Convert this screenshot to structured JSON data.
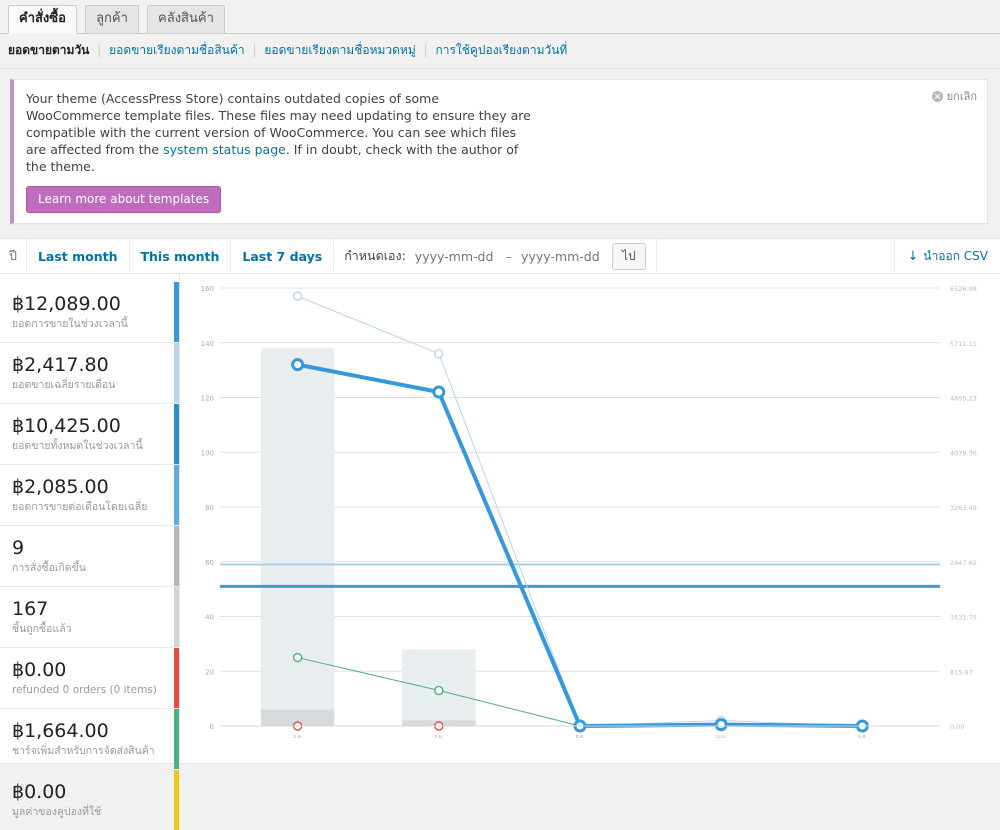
{
  "tabs": [
    {
      "label": "คำสั่งซื้อ",
      "active": true
    },
    {
      "label": "ลูกค้า",
      "active": false
    },
    {
      "label": "คลังสินค้า",
      "active": false
    }
  ],
  "subnav": [
    {
      "label": "ยอดขายตามวัน",
      "current": true
    },
    {
      "label": "ยอดขายเรียงตามชื่อสินค้า",
      "current": false
    },
    {
      "label": "ยอดขายเรียงตามชื่อหมวดหมู่",
      "current": false
    },
    {
      "label": "การใช้คูปองเรียงตามวันที่",
      "current": false
    }
  ],
  "notice": {
    "text_1": "Your theme (AccessPress Store) contains outdated copies of some WooCommerce template files. These files may need updating to ensure they are compatible with the current version of WooCommerce. You can see which files are affected from the ",
    "link_text": "system status page",
    "text_2": ". If in doubt, check with the author of the theme.",
    "button_label": "Learn more about templates",
    "dismiss_label": "ยกเลิก",
    "accent_color": "#c38ec7"
  },
  "toolbar": {
    "year_label": "ปี",
    "last_month": "Last month",
    "this_month": "This month",
    "last_7_days": "Last 7 days",
    "custom_label": "กำหนดเอง:",
    "date_from_placeholder": "yyyy-mm-dd",
    "date_to_placeholder": "yyyy-mm-dd",
    "date_from_value": "",
    "date_to_value": "",
    "dash": "–",
    "go_label": "ไป",
    "export_label": "นำออก CSV"
  },
  "legend": [
    {
      "value": "฿12,089.00",
      "desc": "ยอดการขายในช่วงเวลานี้",
      "color": "#3498db"
    },
    {
      "value": "฿2,417.80",
      "desc": "ยอดขายเฉลี่ยรายเดือน",
      "color": "#b8d5ea"
    },
    {
      "value": "฿10,425.00",
      "desc": "ยอดขายทั้งหมดในช่วงเวลานี้",
      "color": "#2e8ecb"
    },
    {
      "value": "฿2,085.00",
      "desc": "ยอดการขายต่อเดือนโดยเฉลี่ย",
      "color": "#5dade2"
    },
    {
      "value": "9",
      "desc": "การสั่งซื้อเกิดขึ้น",
      "color": "#b0b9bd"
    },
    {
      "value": "167",
      "desc": "ชิ้นถูกซื้อแล้ว",
      "color": "#cfd6d9"
    },
    {
      "value": "฿0.00",
      "desc": "refunded 0 orders (0 items)",
      "color": "#e74c3c"
    },
    {
      "value": "฿1,664.00",
      "desc": "ชาร์จเพิ่มสำหรับการจัดส่งสินค้า",
      "color": "#4caf82"
    },
    {
      "value": "฿0.00",
      "desc": "มูลค่าของคูปองที่ใช้",
      "color": "#f0c419"
    }
  ],
  "chart_data": {
    "type": "line",
    "title": "",
    "xlabel": "",
    "ylabel": "",
    "x": [
      "ม.ค.",
      "ก.พ.",
      "มี.ค.",
      "เม.ย.",
      "พ.ค."
    ],
    "ylim": [
      0,
      160
    ],
    "yticks": [
      0,
      20,
      40,
      60,
      80,
      100,
      120,
      140,
      160
    ],
    "y2lim": [
      0,
      6526.98
    ],
    "y2ticks": [
      "0.00",
      "815.87",
      "1631.75",
      "2447.62",
      "3263.49",
      "4079.36",
      "4895.23",
      "5711.11",
      "6526.98"
    ],
    "grid": true,
    "legend_position": "left-panel",
    "series": [
      {
        "name": "ยอดการขายในช่วงเวลานี้",
        "type": "line",
        "color": "#3498db",
        "width": 4,
        "values": [
          132,
          122,
          0,
          0.5,
          0
        ]
      },
      {
        "name": "ยอดขายทั้งหมดในช่วงเวลานี้",
        "type": "line",
        "color": "#b8d5ea",
        "width": 1,
        "values": [
          157,
          136,
          0,
          2,
          0
        ]
      },
      {
        "name": "ชาร์จเพิ่มสำหรับการจัดส่งสินค้า",
        "type": "line",
        "color": "#4caf82",
        "width": 1,
        "values": [
          25,
          13,
          0,
          0,
          0
        ]
      },
      {
        "name": "refunded 0 orders (0 items)",
        "type": "line",
        "color": "#e74c3c",
        "width": 1,
        "values": [
          0,
          0,
          0,
          0,
          0
        ]
      },
      {
        "name": "ชิ้นถูกซื้อแล้ว",
        "type": "bar",
        "color": "#e8edef",
        "values": [
          138,
          28,
          0,
          0,
          0
        ]
      },
      {
        "name": "การสั่งซื้อเกิดขึ้น",
        "type": "bar",
        "color": "#d5dbdd",
        "values": [
          6,
          2,
          0,
          0,
          0
        ]
      },
      {
        "name": "ยอดขายเฉลี่ยรายเดือน",
        "type": "hline",
        "color": "#a8cfe8",
        "width": 2,
        "value": 59
      },
      {
        "name": "ยอดการขายต่อเดือนโดยเฉลี่ย",
        "type": "hline",
        "color": "#3d9ad6",
        "width": 3,
        "value": 51
      }
    ]
  }
}
